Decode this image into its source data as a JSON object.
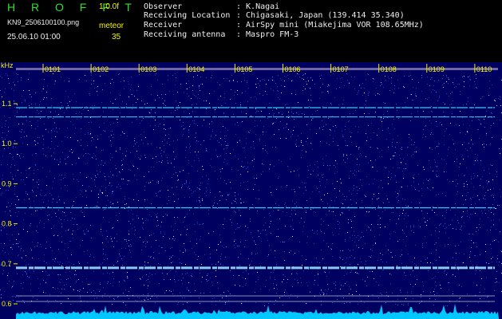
{
  "header": {
    "app_title": "H R O F F T",
    "version": "1.0.0f",
    "filename": "KN9_2506100100.png",
    "meteor_label": "meteor",
    "datetime": "25.06.10 01:00",
    "meteor_count": "35",
    "info": [
      {
        "label": "Observer",
        "value": ": K.Nagai"
      },
      {
        "label": "Receiving Location",
        "value": ": Chigasaki, Japan (139.414 35.340)"
      },
      {
        "label": "Receiver",
        "value": ": AirSpy mini (Miakejima VOR 108.65MHz)"
      },
      {
        "label": "Receiving antenna",
        "value": ": Maspro FM-3"
      }
    ]
  },
  "spectrogram": {
    "unit": "kHz",
    "y_ticks": [
      {
        "label": "1.1",
        "value": 1.1
      },
      {
        "label": "1.0",
        "value": 1.0
      },
      {
        "label": "0.9",
        "value": 0.9
      },
      {
        "label": "0.8",
        "value": 0.8
      },
      {
        "label": "0.7",
        "value": 0.7
      },
      {
        "label": "0.6",
        "value": 0.6
      }
    ],
    "time_labels": [
      "0101",
      "0102",
      "0103",
      "0104",
      "0105",
      "0106",
      "0107",
      "0108",
      "0109",
      "0110"
    ],
    "carrier_lines": [
      {
        "value": 1.09,
        "color": "#33ccee"
      },
      {
        "value": 1.067,
        "color": "#33bbdd"
      },
      {
        "value": 0.84,
        "color": "#33ccee"
      },
      {
        "value": 0.69,
        "color": "#88ccee"
      }
    ],
    "colors": {
      "background": "#000060",
      "tick_label": "#f2f200",
      "time_label": "#f2f200",
      "footer": "#00c8ff"
    }
  }
}
